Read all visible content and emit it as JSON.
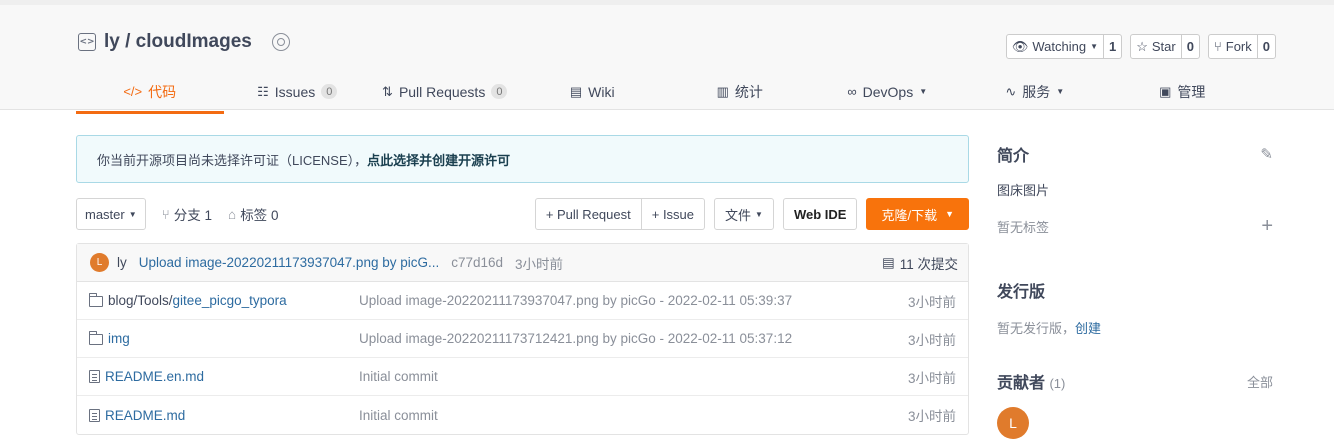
{
  "repo": {
    "title": "ly / cloudImages"
  },
  "actions": [
    {
      "label": "Watching",
      "count": "1",
      "icon": "eye-icon",
      "dropdown": true
    },
    {
      "label": "Star",
      "count": "0",
      "icon": "star-icon",
      "dropdown": false
    },
    {
      "label": "Fork",
      "count": "0",
      "icon": "fork-icon",
      "dropdown": false
    }
  ],
  "tabs": [
    {
      "label": "代码",
      "icon": "code-icon",
      "active": true
    },
    {
      "label": "Issues",
      "count": "0",
      "icon": "issues-icon"
    },
    {
      "label": "Pull Requests",
      "count": "0",
      "icon": "pull-request-icon"
    },
    {
      "label": "Wiki",
      "icon": "wiki-icon"
    },
    {
      "label": "统计",
      "icon": "stats-icon"
    },
    {
      "label": "DevOps",
      "icon": "infinity-icon",
      "dropdown": true
    },
    {
      "label": "服务",
      "icon": "pulse-icon",
      "dropdown": true
    },
    {
      "label": "管理",
      "icon": "manage-icon"
    }
  ],
  "notice": {
    "text": "你当前开源项目尚未选择许可证（LICENSE），",
    "link": "点此选择并创建开源许可"
  },
  "toolbar": {
    "branch": "master",
    "branches": "分支 1",
    "tags": "标签 0",
    "pull_request": "+ Pull Request",
    "issue": "+ Issue",
    "files": "文件",
    "webide": "Web IDE",
    "clone": "克隆/下载"
  },
  "commit": {
    "avatar": "L",
    "author": "ly",
    "message": "Upload image-20220211173937047.png by picG...",
    "sha": "c77d16d",
    "time": "3小时前",
    "count": "11 次提交"
  },
  "files": [
    {
      "type": "folder",
      "prefix": "blog/Tools/",
      "name": "gitee_picgo_typora",
      "message": "Upload image-20220211173937047.png by picGo - 2022-02-11 05:39:37",
      "time": "3小时前"
    },
    {
      "type": "folder",
      "prefix": "",
      "name": "img",
      "message": "Upload image-20220211173712421.png by picGo - 2022-02-11 05:37:12",
      "time": "3小时前"
    },
    {
      "type": "file",
      "prefix": "",
      "name": "README.en.md",
      "message": "Initial commit",
      "time": "3小时前"
    },
    {
      "type": "file",
      "prefix": "",
      "name": "README.md",
      "message": "Initial commit",
      "time": "3小时前"
    }
  ],
  "sidebar": {
    "intro_title": "简介",
    "intro_text": "图床图片",
    "no_tags": "暂无标签",
    "release_title": "发行版",
    "no_release": "暂无发行版，",
    "create": "创建",
    "contrib_title": "贡献者",
    "contrib_count": "(1)",
    "all": "全部",
    "contrib_avatar": "L"
  },
  "colors": {
    "accent": "#f36b12",
    "link": "#2d6ba0",
    "clone_bg": "#f8730c"
  }
}
